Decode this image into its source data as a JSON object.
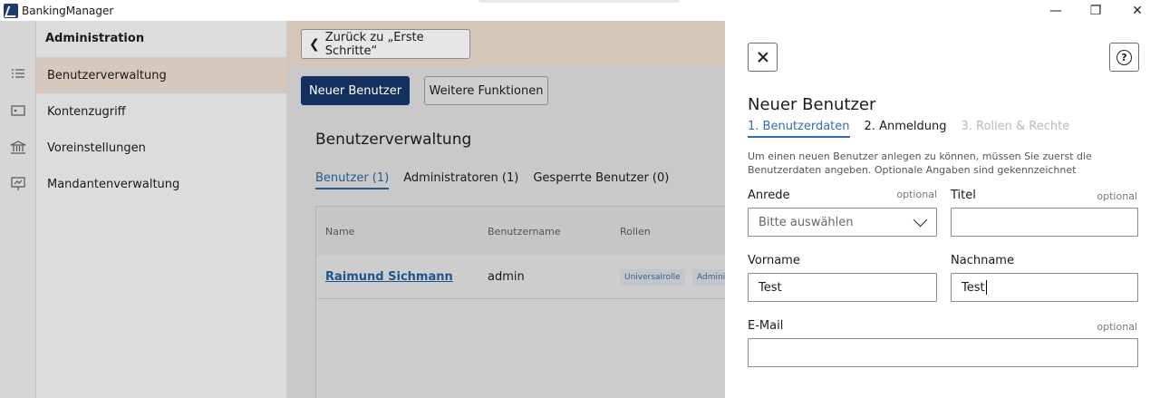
{
  "window": {
    "app_title": "BankingManager",
    "minimize_glyph": "—",
    "maximize_glyph": "❐",
    "close_glyph": "✕"
  },
  "iconbar": {
    "icons": [
      "list-icon",
      "account-card-icon",
      "bank-icon",
      "presentation-icon"
    ]
  },
  "sidebar": {
    "heading": "Administration",
    "items": [
      {
        "label": "Benutzerverwaltung",
        "active": true
      },
      {
        "label": "Kontenzugriff",
        "active": false
      },
      {
        "label": "Voreinstellungen",
        "active": false
      },
      {
        "label": "Mandantenverwaltung",
        "active": false
      }
    ]
  },
  "main": {
    "back_label": "Zurück zu „Erste Schritte“",
    "new_user_label": "Neuer Benutzer",
    "more_functions_label": "Weitere Funktionen",
    "section_title": "Benutzerverwaltung",
    "tabs": [
      {
        "label": "Benutzer (1)",
        "active": true
      },
      {
        "label": "Administratoren (1)",
        "active": false
      },
      {
        "label": "Gesperrte Benutzer (0)",
        "active": false
      }
    ],
    "table": {
      "columns": [
        "Name",
        "Benutzername",
        "Rollen"
      ],
      "rows": [
        {
          "name": "Raimund Sichmann",
          "username": "admin",
          "roles": [
            "Universalrolle",
            "Admini"
          ]
        }
      ]
    }
  },
  "panel": {
    "title": "Neuer Benutzer",
    "steps": [
      {
        "label": "1. Benutzerdaten",
        "state": "active"
      },
      {
        "label": "2. Anmeldung",
        "state": "done"
      },
      {
        "label": "3. Rollen & Rechte",
        "state": "disabled"
      }
    ],
    "description": "Um einen neuen Benutzer anlegen zu können, müssen Sie zuerst die Benutzerdaten angeben. Optionale Angaben sind gekennzeichnet",
    "optional_text": "optional",
    "fields": {
      "anrede": {
        "label": "Anrede",
        "placeholder": "Bitte auswählen"
      },
      "titel": {
        "label": "Titel",
        "value": ""
      },
      "vorname": {
        "label": "Vorname",
        "value": "Test"
      },
      "nachname": {
        "label": "Nachname",
        "value": "Test"
      },
      "email": {
        "label": "E-Mail",
        "value": ""
      }
    },
    "help_glyph": "?"
  },
  "colors": {
    "primary": "#14305e",
    "accent_blue": "#2b6fb5",
    "active_sidebar": "#d6c8bd"
  }
}
